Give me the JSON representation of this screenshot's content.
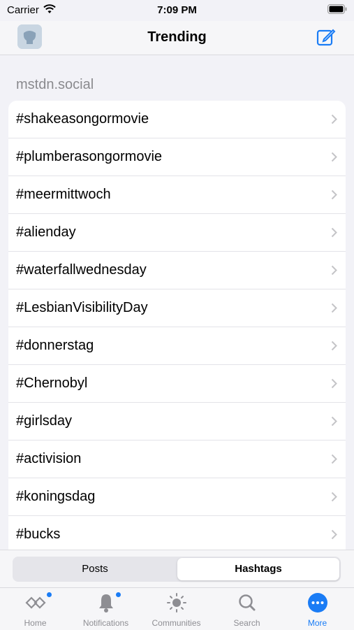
{
  "status": {
    "carrier": "Carrier",
    "time": "7:09 PM"
  },
  "nav": {
    "title": "Trending"
  },
  "section": {
    "label": "mstdn.social"
  },
  "hashtags": [
    "#shakeasongormovie",
    "#plumberasongormovie",
    "#meermittwoch",
    "#alienday",
    "#waterfallwednesday",
    "#LesbianVisibilityDay",
    "#donnerstag",
    "#Chernobyl",
    "#girlsday",
    "#activision",
    "#koningsdag",
    "#bucks"
  ],
  "segment": {
    "posts": "Posts",
    "hashtags": "Hashtags",
    "selected": "Hashtags"
  },
  "tabs": [
    {
      "label": "Home",
      "icon": "home-icon",
      "badge": true
    },
    {
      "label": "Notifications",
      "icon": "bell-icon",
      "badge": true
    },
    {
      "label": "Communities",
      "icon": "sun-icon",
      "badge": false
    },
    {
      "label": "Search",
      "icon": "search-icon",
      "badge": false
    },
    {
      "label": "More",
      "icon": "more-icon",
      "active": true
    }
  ],
  "colors": {
    "accent": "#1a7cf5",
    "background": "#f2f2f7"
  }
}
